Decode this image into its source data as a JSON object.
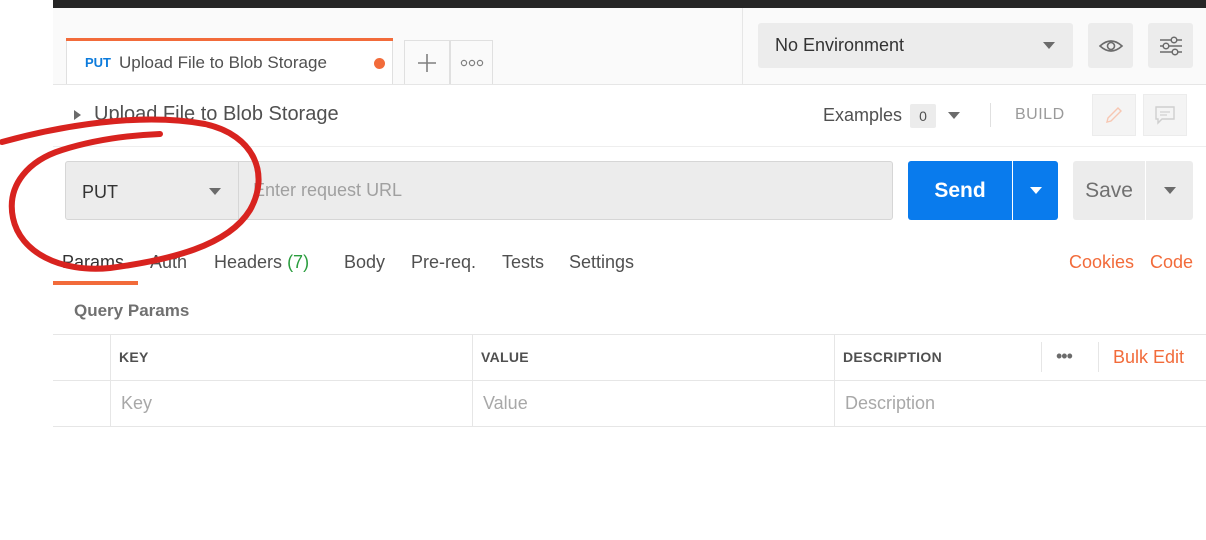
{
  "tab": {
    "method": "PUT",
    "title": "Upload File to Blob Storage"
  },
  "environment": {
    "selected": "No Environment"
  },
  "request": {
    "name": "Upload File to Blob Storage",
    "examples_label": "Examples",
    "examples_count": "0",
    "build_label": "BUILD",
    "method": "PUT",
    "url_placeholder": "Enter request URL",
    "send_label": "Send",
    "save_label": "Save"
  },
  "request_tabs": {
    "params": "Params",
    "auth": "Auth",
    "headers": "Headers",
    "headers_count": "(7)",
    "body": "Body",
    "prereq": "Pre-req.",
    "tests": "Tests",
    "settings": "Settings",
    "cookies": "Cookies",
    "code": "Code"
  },
  "query_params": {
    "title": "Query Params",
    "columns": [
      "KEY",
      "VALUE",
      "DESCRIPTION"
    ],
    "bulk_edit": "Bulk Edit",
    "more": "•••",
    "placeholder_row": [
      "Key",
      "Value",
      "Description"
    ]
  },
  "colors": {
    "accent": "#f26b3a",
    "send_blue": "#097bed",
    "method_blue": "#0c7bdc",
    "annotation_red": "#d8231f"
  },
  "icons": [
    "plus-icon",
    "more-icon",
    "eye-icon",
    "sliders-icon",
    "pencil-icon",
    "comment-icon",
    "caret-down-icon",
    "caret-right-icon"
  ]
}
